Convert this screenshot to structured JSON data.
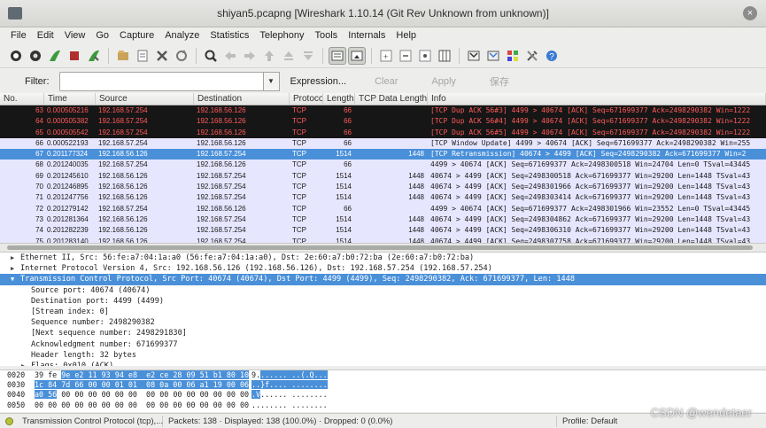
{
  "window": {
    "title": "shiyan5.pcapng  [Wireshark 1.10.14  (Git Rev Unknown from unknown)]"
  },
  "menu": [
    "File",
    "Edit",
    "View",
    "Go",
    "Capture",
    "Analyze",
    "Statistics",
    "Telephony",
    "Tools",
    "Internals",
    "Help"
  ],
  "toolbar": {
    "icons": [
      "interfaces-icon",
      "options-icon",
      "start-capture-icon",
      "stop-capture-icon",
      "restart-capture-icon",
      "open-file-icon",
      "save-file-icon",
      "close-file-icon",
      "reload-icon",
      "find-packet-icon",
      "go-back-icon",
      "go-forward-icon",
      "go-to-packet-icon",
      "go-first-icon",
      "go-last-icon",
      "colorize-icon",
      "autoscroll-icon",
      "zoom-in-icon",
      "zoom-out-icon",
      "normal-size-icon",
      "resize-columns-icon",
      "capture-filters-icon",
      "display-filters-icon",
      "coloring-rules-icon",
      "preferences-icon",
      "help-icon"
    ]
  },
  "filter": {
    "label": "Filter:",
    "value": "",
    "expression": "Expression...",
    "clear": "Clear",
    "apply": "Apply",
    "save": "保存"
  },
  "packet_list": {
    "columns": [
      "No.",
      "Time",
      "Source",
      "Destination",
      "Protocol",
      "Length",
      "TCP Data Length",
      "Info"
    ],
    "rows": [
      {
        "no": "63",
        "time": "0.000505216",
        "src": "192.168.57.254",
        "dst": "192.168.56.126",
        "proto": "TCP",
        "len": "66",
        "tcplen": "",
        "info": "[TCP Dup ACK 56#3] 4499 > 40674 [ACK] Seq=671699377 Ack=2498290382 Win=1222",
        "style": "black"
      },
      {
        "no": "64",
        "time": "0.000505382",
        "src": "192.168.57.254",
        "dst": "192.168.56.126",
        "proto": "TCP",
        "len": "66",
        "tcplen": "",
        "info": "[TCP Dup ACK 56#4] 4499 > 40674 [ACK] Seq=671699377 Ack=2498290382 Win=1222",
        "style": "black"
      },
      {
        "no": "65",
        "time": "0.000505542",
        "src": "192.168.57.254",
        "dst": "192.168.56.126",
        "proto": "TCP",
        "len": "66",
        "tcplen": "",
        "info": "[TCP Dup ACK 56#5] 4499 > 40674 [ACK] Seq=671699377 Ack=2498290382 Win=1222",
        "style": "black"
      },
      {
        "no": "66",
        "time": "0.000522193",
        "src": "192.168.57.254",
        "dst": "192.168.56.126",
        "proto": "TCP",
        "len": "66",
        "tcplen": "",
        "info": "[TCP Window Update] 4499 > 40674 [ACK] Seq=671699377 Ack=2498290382 Win=255",
        "style": "lav"
      },
      {
        "no": "67",
        "time": "0.201177324",
        "src": "192.168.56.126",
        "dst": "192.168.57.254",
        "proto": "TCP",
        "len": "1514",
        "tcplen": "1448",
        "info": "[TCP Retransmission] 40674 > 4499 [ACK] Seq=2498290382 Ack=671699377 Win=2",
        "style": "sel"
      },
      {
        "no": "68",
        "time": "0.201240035",
        "src": "192.168.57.254",
        "dst": "192.168.56.126",
        "proto": "TCP",
        "len": "66",
        "tcplen": "",
        "info": "4499 > 40674 [ACK] Seq=671699377 Ack=2498300518 Win=24704 Len=0 TSval=43445",
        "style": "lav"
      },
      {
        "no": "69",
        "time": "0.201245610",
        "src": "192.168.56.126",
        "dst": "192.168.57.254",
        "proto": "TCP",
        "len": "1514",
        "tcplen": "1448",
        "info": "40674 > 4499 [ACK] Seq=2498300518 Ack=671699377 Win=29200 Len=1448 TSval=43",
        "style": "lav"
      },
      {
        "no": "70",
        "time": "0.201246895",
        "src": "192.168.56.126",
        "dst": "192.168.57.254",
        "proto": "TCP",
        "len": "1514",
        "tcplen": "1448",
        "info": "40674 > 4499 [ACK] Seq=2498301966 Ack=671699377 Win=29200 Len=1448 TSval=43",
        "style": "lav"
      },
      {
        "no": "71",
        "time": "0.201247756",
        "src": "192.168.56.126",
        "dst": "192.168.57.254",
        "proto": "TCP",
        "len": "1514",
        "tcplen": "1448",
        "info": "40674 > 4499 [ACK] Seq=2498303414 Ack=671699377 Win=29200 Len=1448 TSval=43",
        "style": "lav"
      },
      {
        "no": "72",
        "time": "0.201279142",
        "src": "192.168.57.254",
        "dst": "192.168.56.126",
        "proto": "TCP",
        "len": "66",
        "tcplen": "",
        "info": "4499 > 40674 [ACK] Seq=671699377 Ack=2498301966 Win=23552 Len=0 TSval=43445",
        "style": "lav"
      },
      {
        "no": "73",
        "time": "0.201281364",
        "src": "192.168.56.126",
        "dst": "192.168.57.254",
        "proto": "TCP",
        "len": "1514",
        "tcplen": "1448",
        "info": "40674 > 4499 [ACK] Seq=2498304862 Ack=671699377 Win=29200 Len=1448 TSval=43",
        "style": "lav"
      },
      {
        "no": "74",
        "time": "0.201282239",
        "src": "192.168.56.126",
        "dst": "192.168.57.254",
        "proto": "TCP",
        "len": "1514",
        "tcplen": "1448",
        "info": "40674 > 4499 [ACK] Seq=2498306310 Ack=671699377 Win=29200 Len=1448 TSval=43",
        "style": "lav"
      },
      {
        "no": "75",
        "time": "0.201283140",
        "src": "192.168.56.126",
        "dst": "192.168.57.254",
        "proto": "TCP",
        "len": "1514",
        "tcplen": "1448",
        "info": "40674 > 4499 [ACK] Seq=2498307758 Ack=671699377 Win=29200 Len=1448 TSval=43",
        "style": "lav"
      }
    ]
  },
  "details": [
    {
      "text": "Ethernet II, Src: 56:fe:a7:04:1a:a0 (56:fe:a7:04:1a:a0), Dst: 2e:60:a7:b0:72:ba (2e:60:a7:b0:72:ba)",
      "indent": 0,
      "arrow": "right",
      "sel": false
    },
    {
      "text": "Internet Protocol Version 4, Src: 192.168.56.126 (192.168.56.126), Dst: 192.168.57.254 (192.168.57.254)",
      "indent": 0,
      "arrow": "right",
      "sel": false
    },
    {
      "text": "Transmission Control Protocol, Src Port: 40674 (40674), Dst Port: 4499 (4499), Seq: 2498290382, Ack: 671699377, Len: 1448",
      "indent": 0,
      "arrow": "down",
      "sel": true
    },
    {
      "text": "Source port: 40674 (40674)",
      "indent": 1,
      "arrow": "",
      "sel": false
    },
    {
      "text": "Destination port: 4499 (4499)",
      "indent": 1,
      "arrow": "",
      "sel": false
    },
    {
      "text": "[Stream index: 0]",
      "indent": 1,
      "arrow": "",
      "sel": false
    },
    {
      "text": "Sequence number: 2498290382",
      "indent": 1,
      "arrow": "",
      "sel": false
    },
    {
      "text": "[Next sequence number: 2498291830]",
      "indent": 1,
      "arrow": "",
      "sel": false
    },
    {
      "text": "Acknowledgment number: 671699377",
      "indent": 1,
      "arrow": "",
      "sel": false
    },
    {
      "text": "Header length: 32 bytes",
      "indent": 1,
      "arrow": "",
      "sel": false
    },
    {
      "text": "Flags: 0x010 (ACK)",
      "indent": 1,
      "arrow": "right",
      "sel": false
    }
  ],
  "bytes": [
    {
      "off": "0020",
      "pre": "39 fe ",
      "hl": "9e e2 11 93 94 e8  e2 ce 28 09 51 b1 80 10",
      "ascii_pre": "9.",
      "ascii_hl": "...... ..(.Q..."
    },
    {
      "off": "0030",
      "pre": "",
      "hl": "1c 84 7d 66 00 00 01 01  08 0a 00 06 a1 19 00 06",
      "ascii_pre": "",
      "ascii_hl": "..}f.... ........"
    },
    {
      "off": "0040",
      "pre": "",
      "hl": "a0 56",
      "post": " 00 00 00 00 00 00  00 00 00 00 00 00 00 00",
      "ascii_pre": "",
      "ascii_hl": ".V",
      "ascii_post": "...... ........"
    },
    {
      "off": "0050",
      "pre": "",
      "hl": "",
      "post": "00 00 00 00 00 00 00 00  00 00 00 00 00 00 00 00",
      "ascii_pre": "",
      "ascii_hl": "",
      "ascii_post": "........ ........"
    }
  ],
  "status": {
    "field": "Transmission Control Protocol (tcp),...",
    "packets": "Packets: 138 · Displayed: 138 (100.0%) · Dropped: 0 (0.0%)",
    "profile": "Profile: Default"
  },
  "watermark": "CSDN @wendetaer",
  "colors": {
    "black_row_bg": "#161616",
    "black_row_fg": "#ff5a5a",
    "lav_row_bg": "#e7e6ff",
    "selected_bg": "#4a90d9",
    "selected_fg": "#ffffff"
  }
}
